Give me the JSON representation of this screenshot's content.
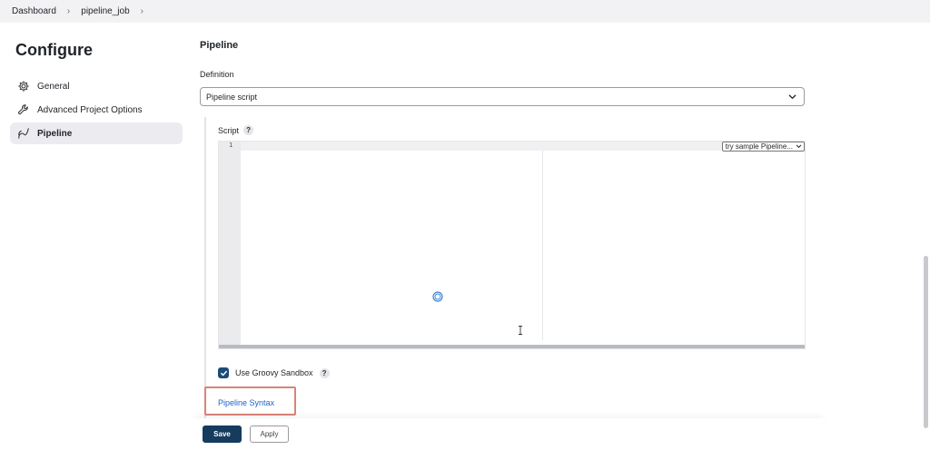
{
  "breadcrumb": {
    "items": [
      "Dashboard",
      "pipeline_job"
    ]
  },
  "sidebar": {
    "title": "Configure",
    "items": [
      {
        "label": "General",
        "icon": "gear-icon",
        "active": false
      },
      {
        "label": "Advanced Project Options",
        "icon": "wrench-icon",
        "active": false
      },
      {
        "label": "Pipeline",
        "icon": "pipeline-icon",
        "active": true
      }
    ]
  },
  "main": {
    "section_title": "Pipeline",
    "definition_label": "Definition",
    "definition_value": "Pipeline script",
    "script_label": "Script",
    "script_help": "?",
    "editor": {
      "line_number": "1",
      "sample_select": "try sample Pipeline..."
    },
    "sandbox_label": "Use Groovy Sandbox",
    "sandbox_help": "?",
    "sandbox_checked": true,
    "syntax_link": "Pipeline Syntax"
  },
  "footer": {
    "save_label": "Save",
    "apply_label": "Apply"
  },
  "colors": {
    "accent": "#153b5e",
    "link": "#1f63c6",
    "highlight_box": "#d9837a"
  }
}
